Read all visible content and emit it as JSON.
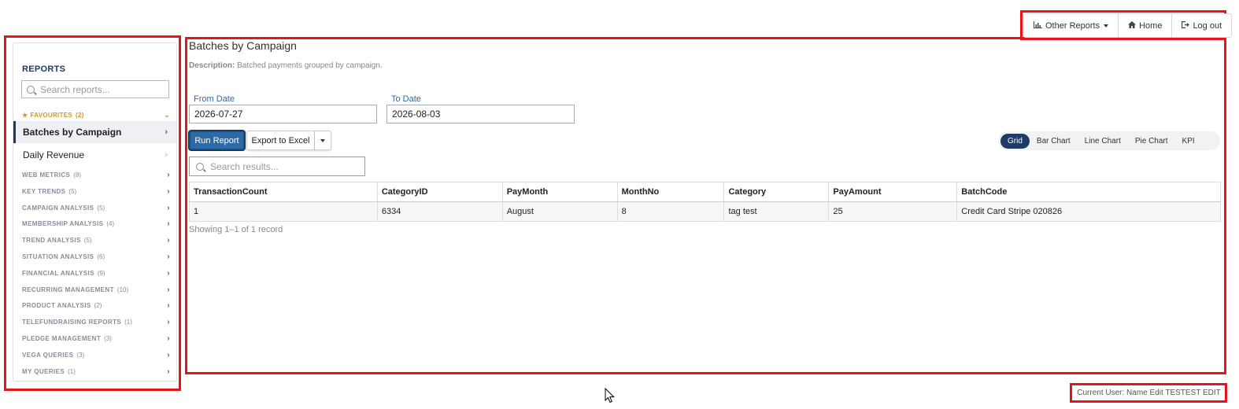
{
  "topnav": {
    "other_reports": "Other Reports",
    "home": "Home",
    "logout": "Log out"
  },
  "sidebar": {
    "title": "REPORTS",
    "search_placeholder": "Search reports...",
    "favourites": {
      "label": "FAVOURITES",
      "count": "(2)"
    },
    "fav_items": [
      {
        "label": "Batches by Campaign",
        "active": true
      },
      {
        "label": "Daily Revenue",
        "active": false
      }
    ],
    "categories": [
      {
        "label": "WEB METRICS",
        "count": "(8)"
      },
      {
        "label": "KEY TRENDS",
        "count": "(5)"
      },
      {
        "label": "CAMPAIGN ANALYSIS",
        "count": "(5)"
      },
      {
        "label": "MEMBERSHIP ANALYSIS",
        "count": "(4)"
      },
      {
        "label": "TREND ANALYSIS",
        "count": "(5)"
      },
      {
        "label": "SITUATION ANALYSIS",
        "count": "(6)"
      },
      {
        "label": "FINANCIAL ANALYSIS",
        "count": "(9)"
      },
      {
        "label": "RECURRING MANAGEMENT",
        "count": "(10)"
      },
      {
        "label": "PRODUCT ANALYSIS",
        "count": "(2)"
      },
      {
        "label": "TELEFUNDRAISING REPORTS",
        "count": "(1)"
      },
      {
        "label": "PLEDGE MANAGEMENT",
        "count": "(3)"
      },
      {
        "label": "VEGA QUERIES",
        "count": "(3)"
      },
      {
        "label": "MY QUERIES",
        "count": "(1)"
      }
    ]
  },
  "main": {
    "title": "Batches by Campaign",
    "description_label": "Description:",
    "description": "Batched payments grouped by campaign.",
    "from_label": "From Date",
    "from_value": "2026-07-27",
    "to_label": "To Date",
    "to_value": "2026-08-03",
    "run_label": "Run Report",
    "export_label": "Export to Excel",
    "search_placeholder": "Search results...",
    "views": [
      "Grid",
      "Bar Chart",
      "Line Chart",
      "Pie Chart",
      "KPI"
    ],
    "active_view": "Grid",
    "columns": [
      "TransactionCount",
      "CategoryID",
      "PayMonth",
      "MonthNo",
      "Category",
      "PayAmount",
      "BatchCode"
    ],
    "rows": [
      [
        "1",
        "6334",
        "August",
        "8",
        "tag test",
        "25",
        "Credit Card Stripe 020826"
      ]
    ],
    "showing": "Showing 1–1 of 1 record"
  },
  "footer": {
    "current_user": "Current User: Name Edit TESTEST EDIT"
  },
  "colors": {
    "annotation_red": "#e8141b",
    "navy": "#1f3a64",
    "run_blue": "#2d6aa5",
    "favourite_gold": "#d49a1a",
    "label_blue": "#2b6aa8"
  }
}
